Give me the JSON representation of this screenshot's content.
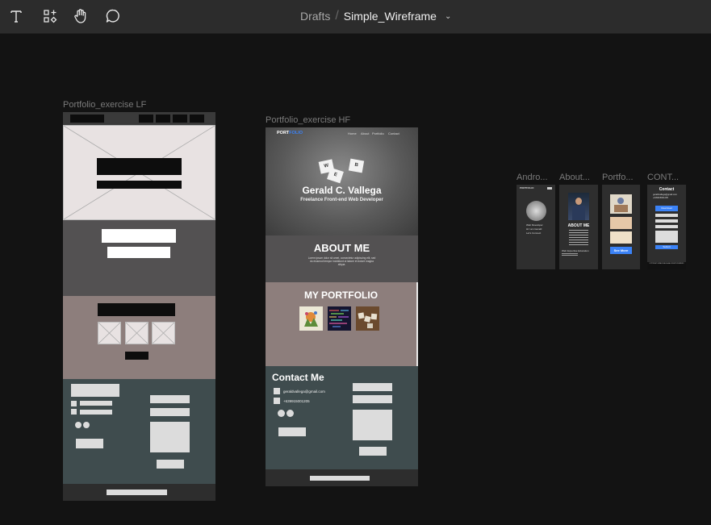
{
  "toolbar": {
    "tools": [
      {
        "name": "text-tool",
        "icon": "text-icon"
      },
      {
        "name": "components-tool",
        "icon": "components-icon"
      },
      {
        "name": "hand-tool",
        "icon": "hand-icon"
      },
      {
        "name": "comment-tool",
        "icon": "comment-icon"
      }
    ],
    "breadcrumb": {
      "project": "Drafts",
      "separator": "/",
      "file": "Simple_Wireframe"
    }
  },
  "frames": {
    "lf": {
      "label": "Portfolio_exercise LF"
    },
    "hf": {
      "label": "Portfolio_exercise HF",
      "logo_a": "PORT",
      "logo_b": "FOLIO",
      "nav": [
        "Home",
        "About",
        "Portfolio",
        "Contact"
      ],
      "hero_name": "Gerald C. Vallega",
      "hero_sub": "Freelance Front-end Web Developer",
      "tiles": [
        "W",
        "E",
        "B"
      ],
      "about_title": "ABOUT ME",
      "about_body": "Lorem ipsum dolor sit amet, consectetur adipiscing elit, sed do eiusmod tempor incididunt ut labore et dolore magna aliqua.",
      "portfolio_title": "MY PORTFOLIO",
      "contact_title": "Contact Me",
      "email": "geraldvallega@gmail.com",
      "phone": "+639915001205"
    },
    "android": {
      "label": "Andro...",
      "logo": "PORTFOLIO",
      "line1": "Web Developer",
      "line2": "Hi I am Gerald",
      "line3": "Let's Connect"
    },
    "about": {
      "label": "About...",
      "title": "ABOUT ME",
      "foot": "Web Expertise Education"
    },
    "portfolio": {
      "label": "Portfo...",
      "button": "See More"
    },
    "contact": {
      "label": "CONT...",
      "title": "Contact",
      "email": "geraldvallega@gmail.com",
      "phone": "+639915001205",
      "button1": "Download",
      "button2": "Submit",
      "footer": "COPYRIGHT GERALD VALLEGA ALL RIGHTS RESERVED"
    }
  },
  "colors": {
    "topbar": "#2c2c2c",
    "canvas": "#131313",
    "lf_section2": "#535152",
    "lf_section3": "#8d7e7c",
    "lf_section4": "#3f4c4e",
    "accent_blue": "#3b82f6"
  }
}
